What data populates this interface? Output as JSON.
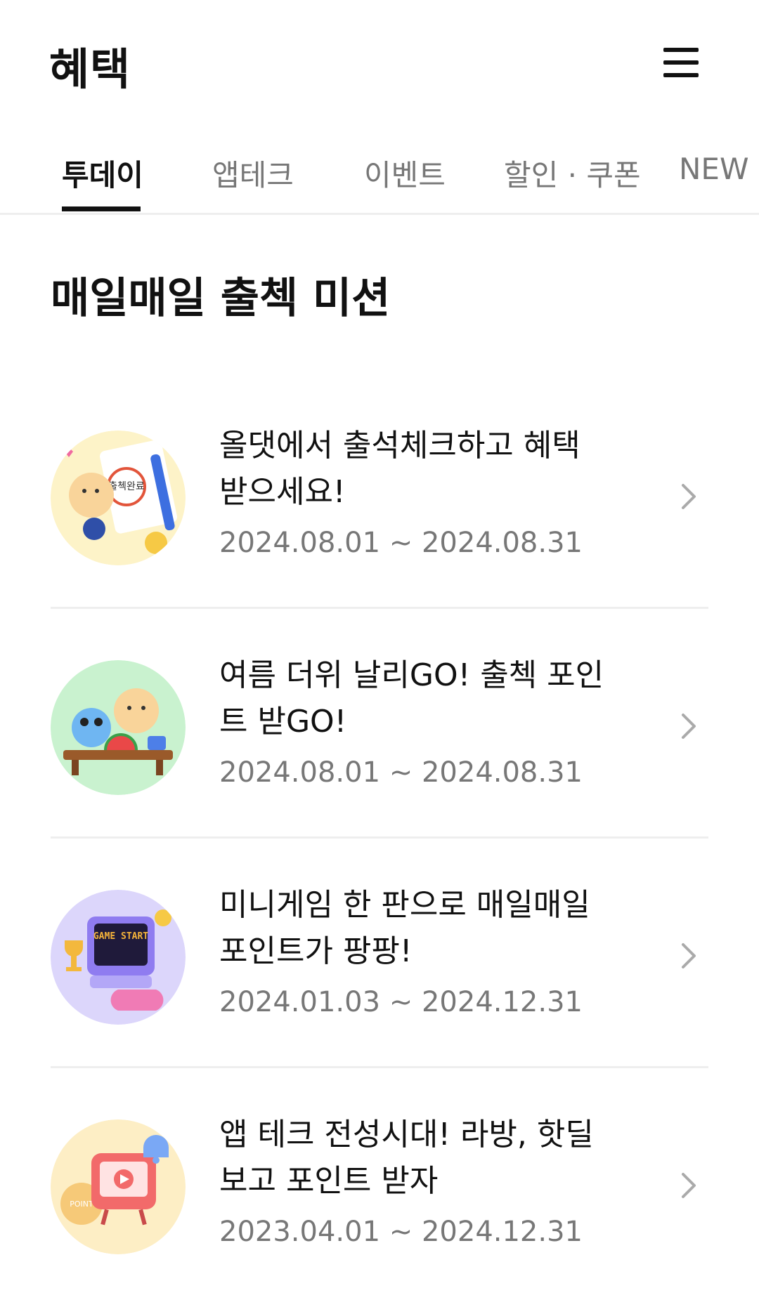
{
  "header": {
    "title": "혜택",
    "menu_icon": "hamburger-menu-icon"
  },
  "tabs": [
    {
      "label": "투데이",
      "active": true
    },
    {
      "label": "앱테크",
      "active": false
    },
    {
      "label": "이벤트",
      "active": false
    },
    {
      "label": "할인 · 쿠폰",
      "active": false
    },
    {
      "label": "NEW",
      "active": false
    }
  ],
  "section": {
    "title": "매일매일 출첵 미션"
  },
  "missions": [
    {
      "title": "올댓에서 출석체크하고 혜택 받으세요!",
      "period": "2024.08.01 ~ 2024.08.31",
      "thumb_bg": "#fdf3c8",
      "thumb_icon": "calendar-stamp-icon",
      "stamp_text": "출첵완료"
    },
    {
      "title": "여름 더위 날리GO! 출첵 포인트 받GO!",
      "period": "2024.08.01 ~ 2024.08.31",
      "thumb_bg": "#c9f2cf",
      "thumb_icon": "summer-watermelon-icon"
    },
    {
      "title": "미니게임 한 판으로 매일매일 포인트가 팡팡!",
      "period": "2024.01.03 ~ 2024.12.31",
      "thumb_bg": "#dcd6fb",
      "thumb_icon": "game-console-icon",
      "screen_text": "GAME START"
    },
    {
      "title": "앱 테크 전성시대! 라방, 핫딜 보고 포인트 받자",
      "period": "2023.04.01 ~ 2024.12.31",
      "thumb_bg": "#fdeec5",
      "thumb_icon": "live-tv-icon",
      "coin_text": "POINT"
    }
  ],
  "colors": {
    "text_primary": "#111111",
    "text_secondary": "#777777",
    "divider": "#eeeeee",
    "chevron": "#aaaaaa"
  }
}
